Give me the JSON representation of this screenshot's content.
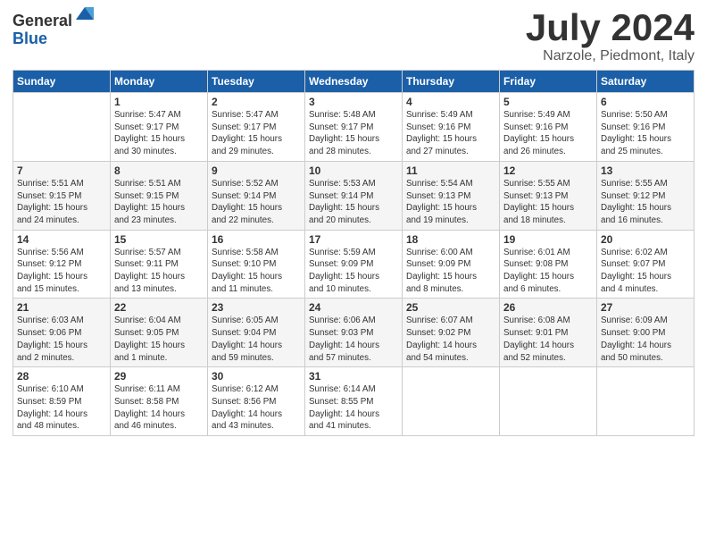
{
  "logo": {
    "general": "General",
    "blue": "Blue"
  },
  "title": "July 2024",
  "location": "Narzole, Piedmont, Italy",
  "headers": [
    "Sunday",
    "Monday",
    "Tuesday",
    "Wednesday",
    "Thursday",
    "Friday",
    "Saturday"
  ],
  "weeks": [
    [
      {
        "day": "",
        "info": ""
      },
      {
        "day": "1",
        "info": "Sunrise: 5:47 AM\nSunset: 9:17 PM\nDaylight: 15 hours\nand 30 minutes."
      },
      {
        "day": "2",
        "info": "Sunrise: 5:47 AM\nSunset: 9:17 PM\nDaylight: 15 hours\nand 29 minutes."
      },
      {
        "day": "3",
        "info": "Sunrise: 5:48 AM\nSunset: 9:17 PM\nDaylight: 15 hours\nand 28 minutes."
      },
      {
        "day": "4",
        "info": "Sunrise: 5:49 AM\nSunset: 9:16 PM\nDaylight: 15 hours\nand 27 minutes."
      },
      {
        "day": "5",
        "info": "Sunrise: 5:49 AM\nSunset: 9:16 PM\nDaylight: 15 hours\nand 26 minutes."
      },
      {
        "day": "6",
        "info": "Sunrise: 5:50 AM\nSunset: 9:16 PM\nDaylight: 15 hours\nand 25 minutes."
      }
    ],
    [
      {
        "day": "7",
        "info": "Sunrise: 5:51 AM\nSunset: 9:15 PM\nDaylight: 15 hours\nand 24 minutes."
      },
      {
        "day": "8",
        "info": "Sunrise: 5:51 AM\nSunset: 9:15 PM\nDaylight: 15 hours\nand 23 minutes."
      },
      {
        "day": "9",
        "info": "Sunrise: 5:52 AM\nSunset: 9:14 PM\nDaylight: 15 hours\nand 22 minutes."
      },
      {
        "day": "10",
        "info": "Sunrise: 5:53 AM\nSunset: 9:14 PM\nDaylight: 15 hours\nand 20 minutes."
      },
      {
        "day": "11",
        "info": "Sunrise: 5:54 AM\nSunset: 9:13 PM\nDaylight: 15 hours\nand 19 minutes."
      },
      {
        "day": "12",
        "info": "Sunrise: 5:55 AM\nSunset: 9:13 PM\nDaylight: 15 hours\nand 18 minutes."
      },
      {
        "day": "13",
        "info": "Sunrise: 5:55 AM\nSunset: 9:12 PM\nDaylight: 15 hours\nand 16 minutes."
      }
    ],
    [
      {
        "day": "14",
        "info": "Sunrise: 5:56 AM\nSunset: 9:12 PM\nDaylight: 15 hours\nand 15 minutes."
      },
      {
        "day": "15",
        "info": "Sunrise: 5:57 AM\nSunset: 9:11 PM\nDaylight: 15 hours\nand 13 minutes."
      },
      {
        "day": "16",
        "info": "Sunrise: 5:58 AM\nSunset: 9:10 PM\nDaylight: 15 hours\nand 11 minutes."
      },
      {
        "day": "17",
        "info": "Sunrise: 5:59 AM\nSunset: 9:09 PM\nDaylight: 15 hours\nand 10 minutes."
      },
      {
        "day": "18",
        "info": "Sunrise: 6:00 AM\nSunset: 9:09 PM\nDaylight: 15 hours\nand 8 minutes."
      },
      {
        "day": "19",
        "info": "Sunrise: 6:01 AM\nSunset: 9:08 PM\nDaylight: 15 hours\nand 6 minutes."
      },
      {
        "day": "20",
        "info": "Sunrise: 6:02 AM\nSunset: 9:07 PM\nDaylight: 15 hours\nand 4 minutes."
      }
    ],
    [
      {
        "day": "21",
        "info": "Sunrise: 6:03 AM\nSunset: 9:06 PM\nDaylight: 15 hours\nand 2 minutes."
      },
      {
        "day": "22",
        "info": "Sunrise: 6:04 AM\nSunset: 9:05 PM\nDaylight: 15 hours\nand 1 minute."
      },
      {
        "day": "23",
        "info": "Sunrise: 6:05 AM\nSunset: 9:04 PM\nDaylight: 14 hours\nand 59 minutes."
      },
      {
        "day": "24",
        "info": "Sunrise: 6:06 AM\nSunset: 9:03 PM\nDaylight: 14 hours\nand 57 minutes."
      },
      {
        "day": "25",
        "info": "Sunrise: 6:07 AM\nSunset: 9:02 PM\nDaylight: 14 hours\nand 54 minutes."
      },
      {
        "day": "26",
        "info": "Sunrise: 6:08 AM\nSunset: 9:01 PM\nDaylight: 14 hours\nand 52 minutes."
      },
      {
        "day": "27",
        "info": "Sunrise: 6:09 AM\nSunset: 9:00 PM\nDaylight: 14 hours\nand 50 minutes."
      }
    ],
    [
      {
        "day": "28",
        "info": "Sunrise: 6:10 AM\nSunset: 8:59 PM\nDaylight: 14 hours\nand 48 minutes."
      },
      {
        "day": "29",
        "info": "Sunrise: 6:11 AM\nSunset: 8:58 PM\nDaylight: 14 hours\nand 46 minutes."
      },
      {
        "day": "30",
        "info": "Sunrise: 6:12 AM\nSunset: 8:56 PM\nDaylight: 14 hours\nand 43 minutes."
      },
      {
        "day": "31",
        "info": "Sunrise: 6:14 AM\nSunset: 8:55 PM\nDaylight: 14 hours\nand 41 minutes."
      },
      {
        "day": "",
        "info": ""
      },
      {
        "day": "",
        "info": ""
      },
      {
        "day": "",
        "info": ""
      }
    ]
  ]
}
